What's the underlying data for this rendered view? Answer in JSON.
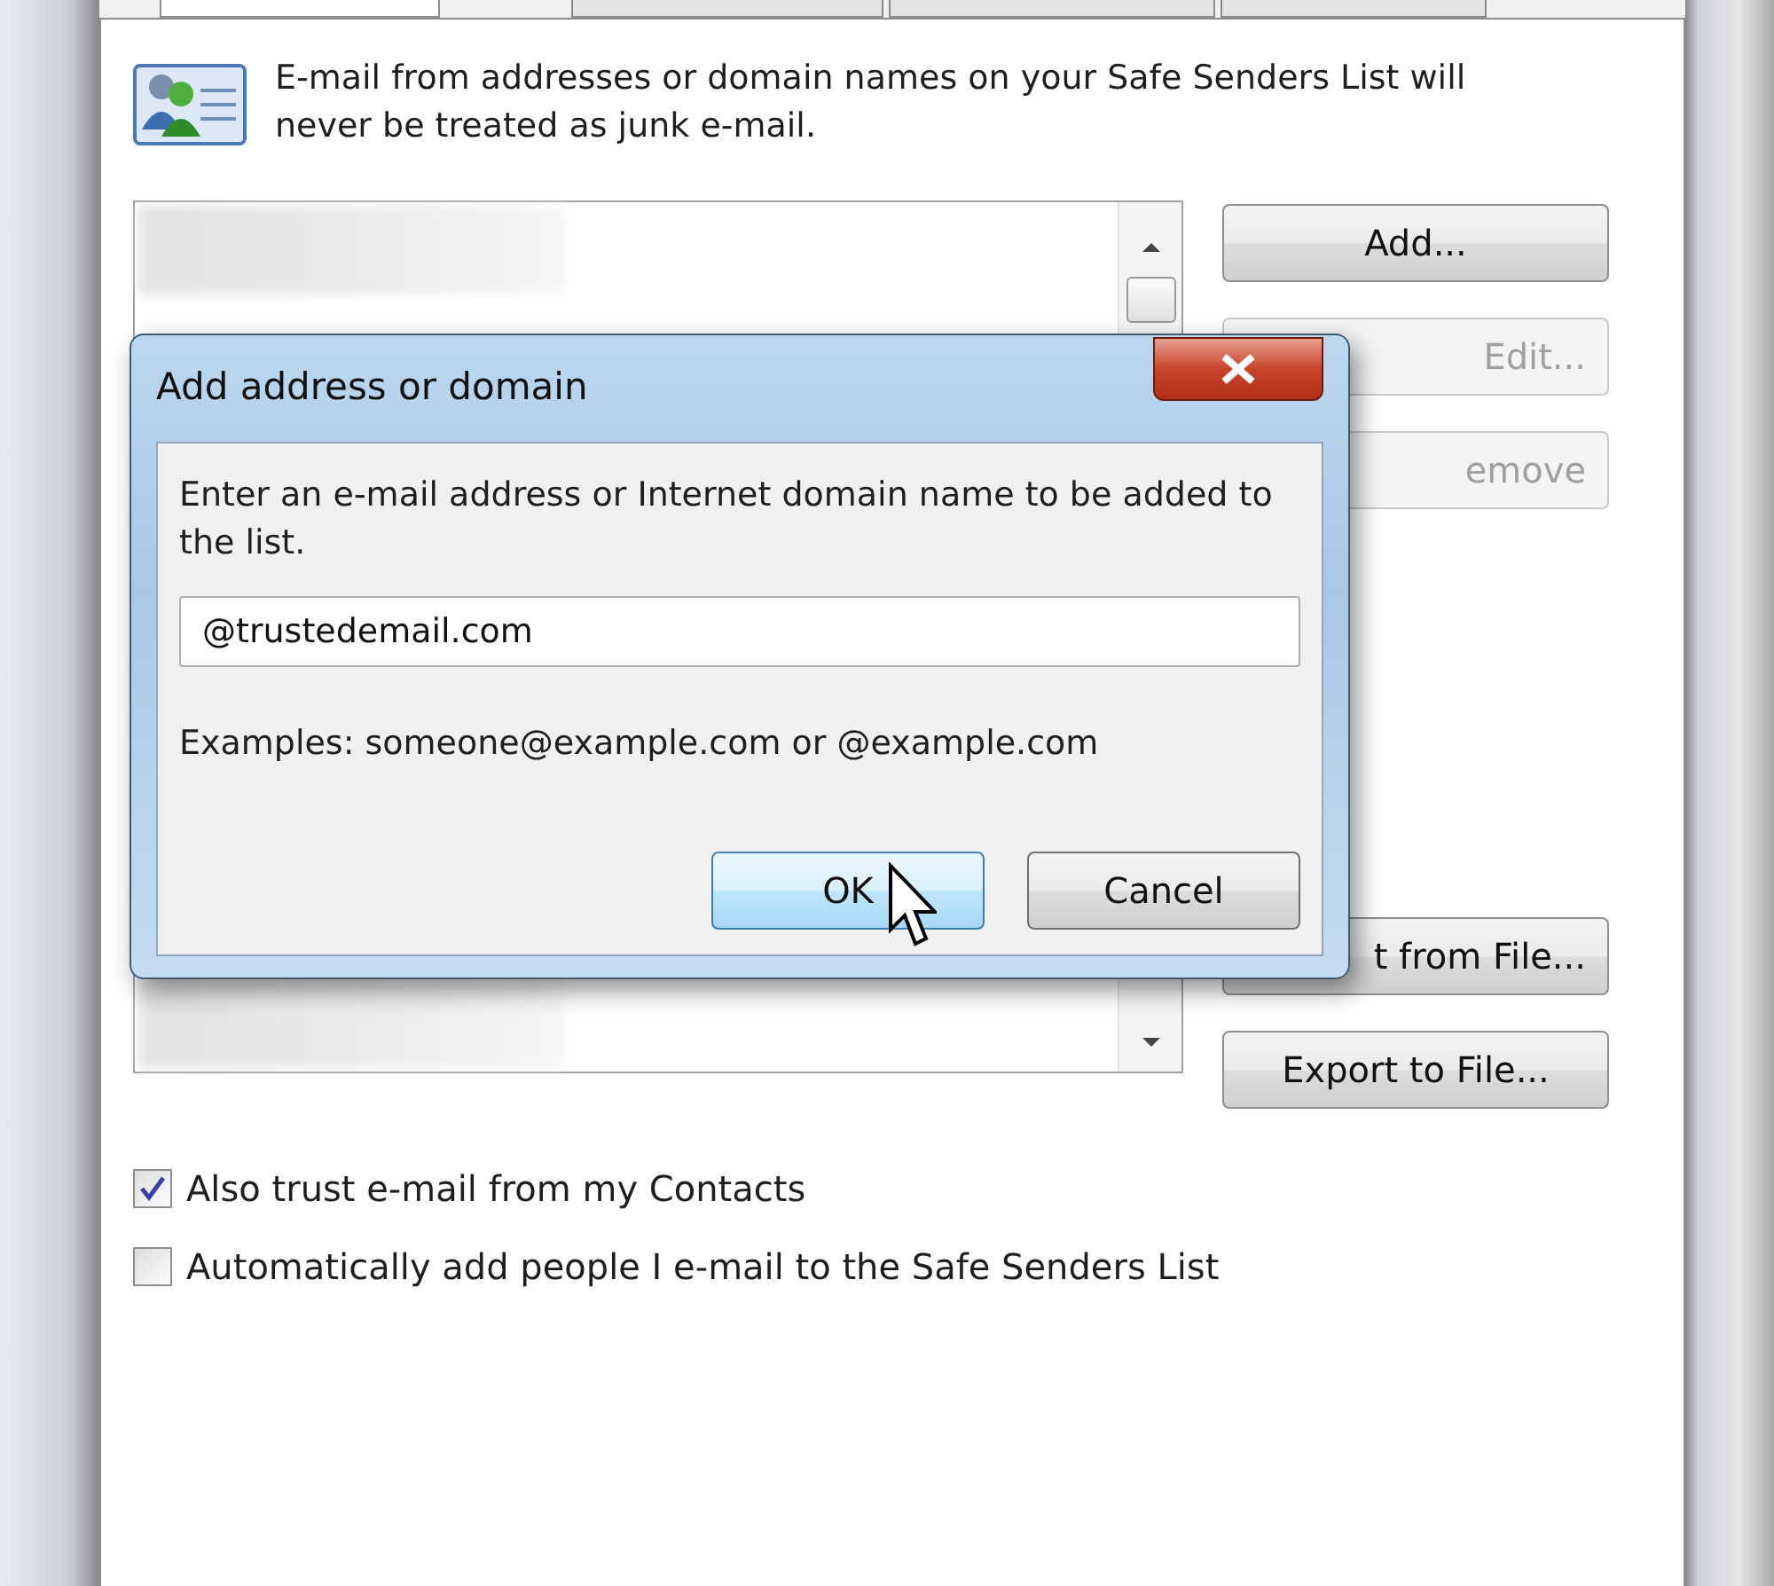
{
  "tabs": [
    {
      "selected": true
    },
    {
      "selected": false
    },
    {
      "selected": false
    },
    {
      "selected": false
    }
  ],
  "description": "E-mail from addresses or domain names on your Safe Senders List will never be treated as junk e-mail.",
  "list": {
    "entries": [
      {
        "kind": "blurred"
      },
      {
        "kind": "blurred"
      }
    ]
  },
  "side_buttons": [
    {
      "label": "Add...",
      "disabled": false,
      "covered": false
    },
    {
      "label": "Edit...",
      "disabled": true,
      "covered": true
    },
    {
      "label": "emove",
      "disabled": true,
      "covered": true
    },
    {
      "label": "t from File...",
      "disabled": false,
      "covered": true
    },
    {
      "label": "Export to File...",
      "disabled": false,
      "covered": false
    }
  ],
  "options": [
    {
      "label": "Also trust e-mail from my Contacts",
      "checked": true
    },
    {
      "label": "Automatically add people I e-mail to the Safe Senders List",
      "checked": false
    }
  ],
  "dialog": {
    "title": "Add address or domain",
    "prompt": "Enter an e-mail address or Internet domain name to be added to the list.",
    "value": "@trustedemail.com",
    "examples": "Examples: someone@example.com or @example.com",
    "buttons": [
      {
        "label": "OK",
        "focused": true
      },
      {
        "label": "Cancel",
        "focused": false
      }
    ]
  }
}
